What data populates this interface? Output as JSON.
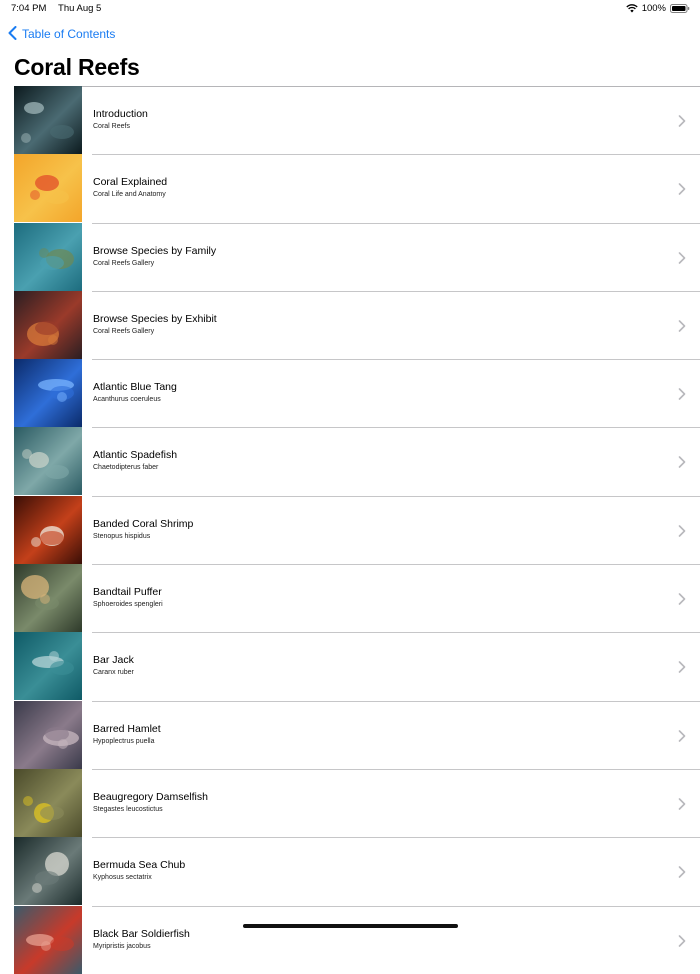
{
  "status": {
    "time": "7:04 PM",
    "date": "Thu Aug 5",
    "battery": "100%"
  },
  "nav": {
    "back_label": "Table of Contents"
  },
  "page_title": "Coral Reefs",
  "items": [
    {
      "title": "Introduction",
      "subtitle": "Coral Reefs",
      "colors": [
        "#0c1a1e",
        "#4a6a72",
        "#9fb5b8"
      ]
    },
    {
      "title": "Coral Explained",
      "subtitle": "Coral Life and Anatomy",
      "colors": [
        "#f3a52a",
        "#f7c24a",
        "#e24e2a"
      ]
    },
    {
      "title": "Browse Species by Family",
      "subtitle": "Coral Reefs Gallery",
      "colors": [
        "#1d6c7e",
        "#4aa0b0",
        "#6b8a58"
      ]
    },
    {
      "title": "Browse Species by Exhibit",
      "subtitle": "Coral Reefs Gallery",
      "colors": [
        "#2a1e22",
        "#9a3a2a",
        "#d87a3a"
      ]
    },
    {
      "title": "Atlantic Blue Tang",
      "subtitle": "Acanthurus coeruleus",
      "colors": [
        "#0a2a6a",
        "#2f6ed8",
        "#7ab4ff"
      ]
    },
    {
      "title": "Atlantic Spadefish",
      "subtitle": "Chaetodipterus faber",
      "colors": [
        "#2a5a62",
        "#7fa8a8",
        "#c7d2c8"
      ]
    },
    {
      "title": "Banded Coral Shrimp",
      "subtitle": "Stenopus hispidus",
      "colors": [
        "#3a0e06",
        "#c4401a",
        "#f0ece0"
      ]
    },
    {
      "title": "Bandtail Puffer",
      "subtitle": "Sphoeroides spengleri",
      "colors": [
        "#2e3a2a",
        "#7a8a6a",
        "#d8b47a"
      ]
    },
    {
      "title": "Bar Jack",
      "subtitle": "Caranx ruber",
      "colors": [
        "#0f5a66",
        "#3a8e96",
        "#b8d6d8"
      ]
    },
    {
      "title": "Barred Hamlet",
      "subtitle": "Hypoplectrus puella",
      "colors": [
        "#3a3a4a",
        "#8a7a8a",
        "#c8b8c0"
      ]
    },
    {
      "title": "Beaugregory Damselfish",
      "subtitle": "Stegastes leucostictus",
      "colors": [
        "#4a4a2a",
        "#8a8a5a",
        "#e0c420"
      ]
    },
    {
      "title": "Bermuda Sea Chub",
      "subtitle": "Kyphosus sectatrix",
      "colors": [
        "#1a2a2a",
        "#6a7a78",
        "#d8d8d0"
      ]
    },
    {
      "title": "Black Bar Soldierfish",
      "subtitle": "Myripristis jacobus",
      "colors": [
        "#3a5a6a",
        "#c83a2a",
        "#e8a090"
      ]
    }
  ]
}
